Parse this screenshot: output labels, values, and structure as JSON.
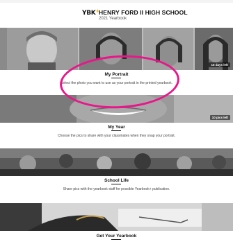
{
  "header": {
    "logo_text": "YBK",
    "logo_plus": "+",
    "school_name": "HENRY FORD II HIGH SCHOOL",
    "subtitle": "2021 Yearbook"
  },
  "sections": [
    {
      "title": "My Portrait",
      "description": "Select the photo you want to use as your portrait in the printed yearbook.",
      "badge": "15 days left"
    },
    {
      "title": "My Year",
      "description": "Choose the pics to share with your classmates when they snap your portrait.",
      "badge": "10 pics left"
    },
    {
      "title": "School Life",
      "description": "Share pics with the yearbook staff for possible Yearbook+ publication."
    },
    {
      "title": "Get Your Yearbook"
    }
  ],
  "colors": {
    "highlight_ring": "#e8178a",
    "logo_accent": "#f2a900"
  }
}
